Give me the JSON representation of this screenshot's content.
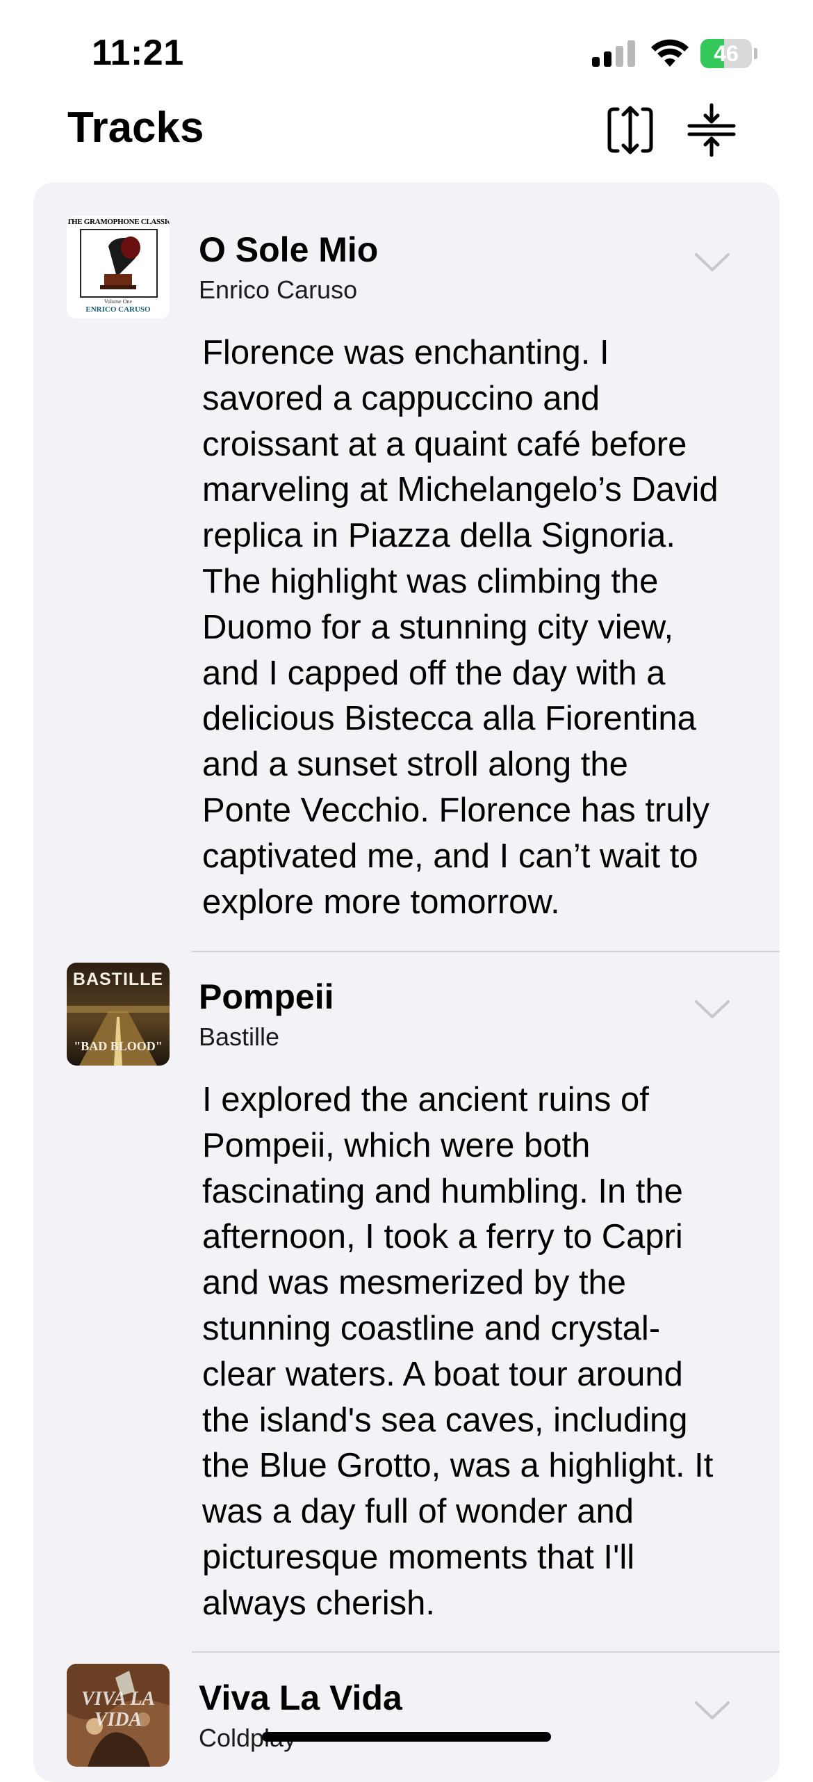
{
  "status_bar": {
    "time": "11:21",
    "battery_percent": "46",
    "battery_level": 0.46,
    "battery_color": "#34c759"
  },
  "header": {
    "title": "Tracks",
    "icons": [
      "expand-icon",
      "collapse-icon"
    ]
  },
  "tracks": [
    {
      "title": "O Sole Mio",
      "artist": "Enrico Caruso",
      "artwork": {
        "top_text": "THE GRAMOPHONE CLASSICS",
        "sub_text": "Volume One",
        "bottom_text": "ENRICO CARUSO"
      },
      "note": "Florence was enchanting. I\nsavored a cappuccino and\ncroissant at a quaint café before\nmarveling at Michelangelo’s David\nreplica in Piazza della Signoria.\nThe highlight was climbing the\nDuomo for a stunning city view,\nand I capped off the day with a\ndelicious Bistecca alla Fiorentina\nand a sunset stroll along the\nPonte Vecchio. Florence has truly\ncaptivated me, and I can’t wait to\nexplore more tomorrow."
    },
    {
      "title": "Pompeii",
      "artist": "Bastille",
      "artwork": {
        "top_text": "BASTILLE",
        "bottom_text": "\"BAD BLOOD\""
      },
      "note": "I explored the ancient ruins of\nPompeii, which were both\nfascinating and humbling. In the\nafternoon, I took a ferry to Capri\nand was mesmerized by the\nstunning coastline and crystal-\nclear waters. A boat tour around\nthe island's sea caves, including\nthe Blue Grotto, was a highlight. It\nwas a day full of wonder and\npicturesque moments that I'll\nalways cherish."
    },
    {
      "title": "Viva La Vida",
      "artist": "Coldplay",
      "artwork": {
        "overlay_text": "VIVA LA VIDA"
      }
    }
  ]
}
